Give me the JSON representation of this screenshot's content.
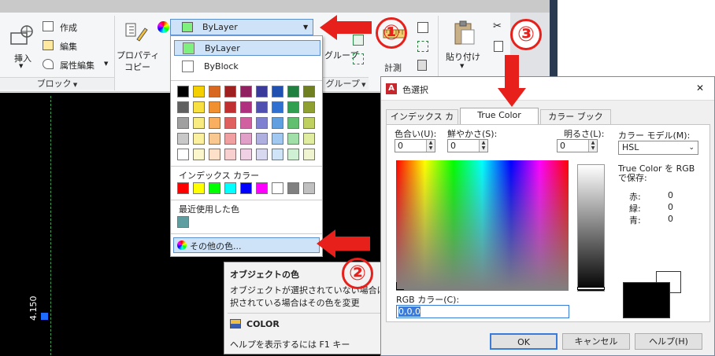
{
  "ribbon": {
    "create_label": "作成",
    "edit_label": "編集",
    "attr_edit_label": "属性編集",
    "insert_label": "挿入",
    "block_panel": "ブロック",
    "properties_label_1": "プロパティ",
    "properties_label_2": "コピー",
    "group_label": "グループ",
    "group_panel": "グループ",
    "measure_label": "計測",
    "paste_label": "貼り付け"
  },
  "color_combo": {
    "selected": "ByLayer",
    "selected_color": "#7ef07e"
  },
  "color_dropdown": {
    "items": [
      {
        "label": "ByLayer",
        "color": "#7ef07e"
      },
      {
        "label": "ByBlock",
        "color": "#ffffff"
      }
    ],
    "palette": [
      [
        "#000000",
        "#f5d000",
        "#d86820",
        "#a02020",
        "#902060",
        "#3a3a9a",
        "#2050b0",
        "#208040",
        "#708020"
      ],
      [
        "#606060",
        "#f8e040",
        "#f09030",
        "#c03030",
        "#b03080",
        "#5050b0",
        "#3070d0",
        "#30a050",
        "#90a030"
      ],
      [
        "#a0a0a0",
        "#f8ec80",
        "#f8b060",
        "#e06060",
        "#d060a0",
        "#8080d0",
        "#60a0e0",
        "#60c070",
        "#c0d060"
      ],
      [
        "#c8c8c8",
        "#faf0a0",
        "#f8c890",
        "#f0a0a0",
        "#e0a0c8",
        "#b0b0e0",
        "#a0c8f0",
        "#a0e0a8",
        "#e0ecA0"
      ],
      [
        "#ffffff",
        "#fcf6cc",
        "#fce0c8",
        "#f8d0d0",
        "#f0d0e4",
        "#d8d8f0",
        "#d0e4f8",
        "#d0f0d4",
        "#f0f4d0"
      ]
    ],
    "index_label": "インデックス カラー",
    "index_colors": [
      "#ff0000",
      "#ffff00",
      "#00ff00",
      "#00ffff",
      "#0000ff",
      "#ff00ff",
      "#ffffff",
      "#808080",
      "#c0c0c0"
    ],
    "recent_label": "最近使用した色",
    "recent_colors": [
      "#5f9ea0"
    ],
    "more_colors": "その他の色..."
  },
  "tooltip": {
    "title": "オブジェクトの色",
    "desc_1": "オブジェクトが選択されていない場合は現",
    "desc_2": "択されている場合はその色を変更",
    "command": "COLOR",
    "help": "ヘルプを表示するには F1 キー"
  },
  "dialog": {
    "title": "色選択",
    "close": "✕",
    "tabs": [
      "インデックス カラー",
      "True Color",
      "カラー ブック"
    ],
    "hue_label": "色合い(U):",
    "hue_value": "0",
    "sat_label": "鮮やかさ(S):",
    "sat_value": "0",
    "lum_label": "明るさ(L):",
    "lum_value": "0",
    "model_label": "カラー モデル(M):",
    "model_value": "HSL",
    "store_label_1": "True Color を RGB",
    "store_label_2": "で保存:",
    "red_label": "赤:",
    "red_value": "0",
    "green_label": "緑:",
    "green_value": "0",
    "blue_label": "青:",
    "blue_value": "0",
    "rgb_label": "RGB カラー(C):",
    "rgb_value": "0,0,0",
    "ok": "OK",
    "cancel": "キャンセル",
    "help": "ヘルプ(H)"
  },
  "canvas": {
    "dim_text": "4.150"
  },
  "annotations": {
    "n1": "①",
    "n2": "②",
    "n3": "③",
    "color": "#e8201c"
  }
}
